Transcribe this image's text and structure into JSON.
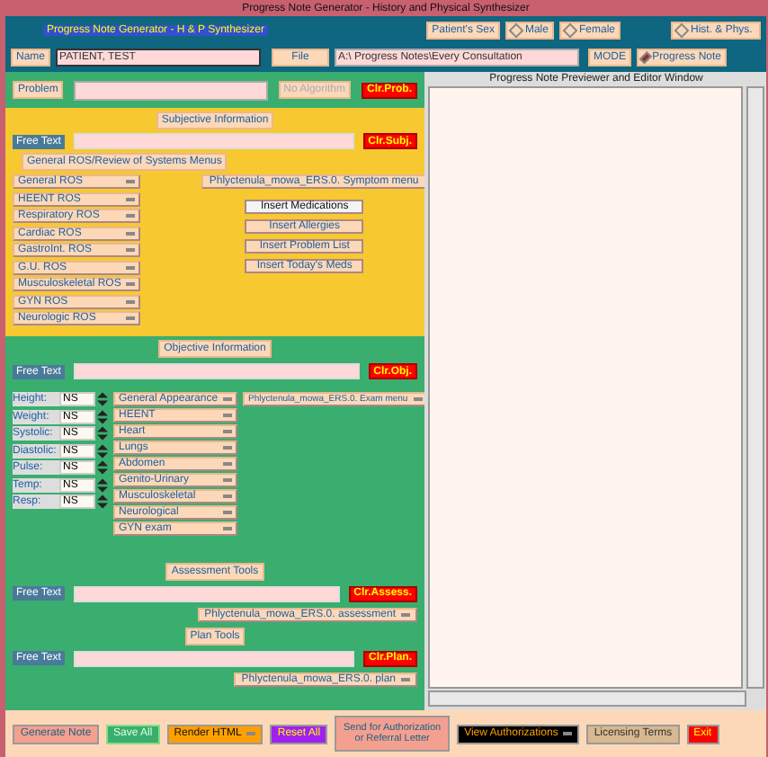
{
  "window": {
    "title": "Progress Note Generator - History and Physical Synthesizer"
  },
  "header": {
    "app_label": "Progress Note Generator - H & P Synthesizer",
    "name_label": "Name",
    "name_value": "PATIENT, TEST",
    "file_button": "File",
    "file_value": "A:\\ Progress Notes\\Every Consultation",
    "sex_label": "Patient's Sex",
    "sex_options": [
      {
        "label": "Male",
        "selected": false
      },
      {
        "label": "Female",
        "selected": false
      }
    ],
    "mode_label": "MODE",
    "mode_options": [
      {
        "label": "Hist. & Phys.",
        "selected": false
      },
      {
        "label": "Progress Note",
        "selected": true
      }
    ]
  },
  "problem": {
    "label": "Problem",
    "no_algorithm": "No Algorithm",
    "clear": "Clr.Prob."
  },
  "subjective": {
    "title": "Subjective Information",
    "free_text": "Free Text",
    "clear": "Clr.Subj.",
    "ros_title": "General ROS/Review of Systems Menus",
    "ros_menus": [
      "General ROS",
      "HEENT ROS",
      "Respiratory ROS",
      "Cardiac ROS",
      "GastroInt. ROS",
      "G.U. ROS",
      "Musculoskeletal ROS",
      "GYN ROS",
      "Neurologic ROS"
    ],
    "symptom_menu": "Phlyctenula_mowa_ERS.0. Symptom menu",
    "inserts": [
      {
        "label": "Insert Medications",
        "selected": true
      },
      {
        "label": "Insert Allergies",
        "selected": false
      },
      {
        "label": "Insert Problem List",
        "selected": false
      },
      {
        "label": "Insert Today's Meds",
        "selected": false
      }
    ]
  },
  "objective": {
    "title": "Objective Information",
    "free_text": "Free Text",
    "clear": "Clr.Obj.",
    "vitals": [
      {
        "label": "Height:",
        "value": "NS"
      },
      {
        "label": "Weight:",
        "value": "NS"
      },
      {
        "label": "Systolic:",
        "value": "NS"
      },
      {
        "label": "Diastolic:",
        "value": "NS"
      },
      {
        "label": "Pulse:",
        "value": "NS"
      },
      {
        "label": "Temp:",
        "value": "NS"
      },
      {
        "label": "Resp:",
        "value": "NS"
      }
    ],
    "exam_menus": [
      "General Appearance",
      "HEENT",
      "Heart",
      "Lungs",
      "Abdomen",
      "Genito-Urinary",
      "Musculoskeletal",
      "Neurological",
      "GYN exam"
    ],
    "exam_menu": "Phlyctenula_mowa_ERS.0. Exam menu"
  },
  "assessment": {
    "title": "Assessment Tools",
    "free_text": "Free Text",
    "clear": "Clr.Assess.",
    "menu": "Phlyctenula_mowa_ERS.0. assessment"
  },
  "plan": {
    "title": "Plan Tools",
    "free_text": "Free Text",
    "clear": "Clr.Plan.",
    "menu": "Phlyctenula_mowa_ERS.0. plan"
  },
  "preview": {
    "title": "Progress Note Previewer and Editor Window"
  },
  "footer": [
    {
      "label": "Generate Note",
      "kind": "salmon"
    },
    {
      "label": "Save All",
      "kind": "green"
    },
    {
      "label": "Render HTML",
      "kind": "menu"
    },
    {
      "label": "Reset All",
      "kind": "purple"
    },
    {
      "label": "Send for Authorization or Referral Letter",
      "kind": "salmon"
    },
    {
      "label": "View Authorizations",
      "kind": "dark"
    },
    {
      "label": "Licensing Terms",
      "kind": "tan"
    },
    {
      "label": "Exit",
      "kind": "red"
    }
  ]
}
